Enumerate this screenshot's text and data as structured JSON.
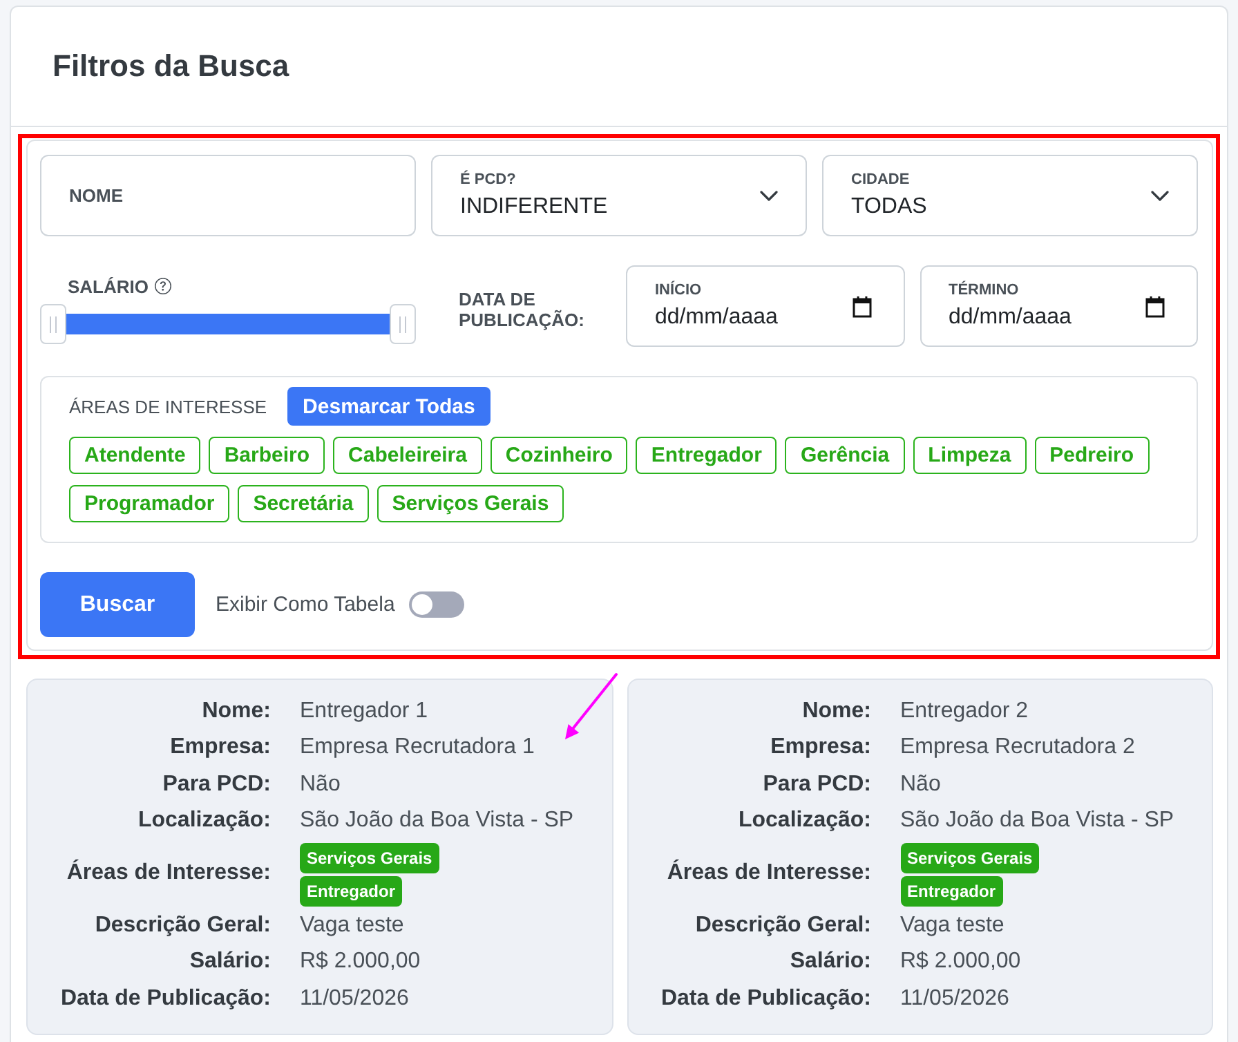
{
  "header": {
    "title": "Filtros da Busca"
  },
  "filters": {
    "nome": {
      "label": "NOME"
    },
    "pcd": {
      "label": "É PCD?",
      "value": "INDIFERENTE"
    },
    "cidade": {
      "label": "CIDADE",
      "value": "TODAS"
    },
    "salario": {
      "label": "SALÁRIO",
      "handles": [
        {
          "level": 0
        },
        {
          "level": 1
        }
      ]
    },
    "data_publicacao": {
      "label": "DATA DE PUBLICAÇÃO:",
      "inicio": {
        "label": "INÍCIO",
        "placeholder": "dd/mm/aaaa"
      },
      "termino": {
        "label": "TÉRMINO",
        "placeholder": "dd/mm/aaaa"
      }
    },
    "areas": {
      "label": "ÁREAS DE INTERESSE",
      "toggle_all_button": "Desmarcar Todas",
      "options": [
        {
          "label": "Atendente",
          "selected": false
        },
        {
          "label": "Barbeiro",
          "selected": false
        },
        {
          "label": "Cabeleireira",
          "selected": false
        },
        {
          "label": "Cozinheiro",
          "selected": false
        },
        {
          "label": "Entregador",
          "selected": false
        },
        {
          "label": "Gerência",
          "selected": false
        },
        {
          "label": "Limpeza",
          "selected": false
        },
        {
          "label": "Pedreiro",
          "selected": false
        },
        {
          "label": "Programador",
          "selected": false
        },
        {
          "label": "Secretária",
          "selected": false
        },
        {
          "label": "Serviços Gerais",
          "selected": false
        }
      ]
    },
    "search_button": "Buscar",
    "table_view": {
      "label": "Exibir Como Tabela",
      "on": false
    }
  },
  "results": [
    {
      "fields": [
        {
          "kind": "text",
          "label": "Nome:",
          "value": "Entregador 1"
        },
        {
          "kind": "text",
          "label": "Empresa:",
          "value": "Empresa Recrutadora 1"
        },
        {
          "kind": "text",
          "label": "Para PCD:",
          "value": "Não"
        },
        {
          "kind": "text",
          "label": "Localização:",
          "value": "São João da Boa Vista - SP"
        },
        {
          "kind": "tags",
          "label": "Áreas de Interesse:",
          "tags": [
            "Serviços Gerais",
            "Entregador"
          ]
        },
        {
          "kind": "text",
          "label": "Descrição Geral:",
          "value": "Vaga teste"
        },
        {
          "kind": "text",
          "label": "Salário:",
          "value": "R$ 2.000,00"
        },
        {
          "kind": "text",
          "label": "Data de Publicação:",
          "value": "11/05/2026"
        }
      ]
    },
    {
      "fields": [
        {
          "kind": "text",
          "label": "Nome:",
          "value": "Entregador 2"
        },
        {
          "kind": "text",
          "label": "Empresa:",
          "value": "Empresa Recrutadora 2"
        },
        {
          "kind": "text",
          "label": "Para PCD:",
          "value": "Não"
        },
        {
          "kind": "text",
          "label": "Localização:",
          "value": "São João da Boa Vista - SP"
        },
        {
          "kind": "tags",
          "label": "Áreas de Interesse:",
          "tags": [
            "Serviços Gerais",
            "Entregador"
          ]
        },
        {
          "kind": "text",
          "label": "Descrição Geral:",
          "value": "Vaga teste"
        },
        {
          "kind": "text",
          "label": "Salário:",
          "value": "R$ 2.000,00"
        },
        {
          "kind": "text",
          "label": "Data de Publicação:",
          "value": "11/05/2026"
        }
      ]
    }
  ]
}
